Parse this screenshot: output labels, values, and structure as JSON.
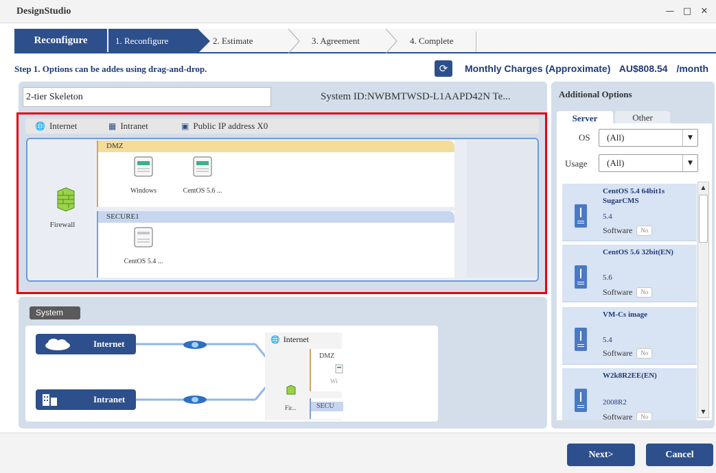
{
  "window": {
    "title": "DesignStudio",
    "minimize_icon": "minimize-icon",
    "maximize_icon": "maximize-icon",
    "close_icon": "close-icon"
  },
  "wizard": {
    "home_label": "Reconfigure",
    "steps": [
      {
        "label": "1. Reconfigure",
        "active": true
      },
      {
        "label": "2. Estimate",
        "active": false
      },
      {
        "label": "3. Agreement",
        "active": false
      },
      {
        "label": "4. Complete",
        "active": false
      }
    ]
  },
  "step_bar": {
    "instruction": "Step 1. Options can be addes using drag-and-drop.",
    "refresh_icon": "refresh-icon",
    "monthly_label": "Monthly Charges (Approximate)",
    "monthly_amount": "AU$808.54",
    "monthly_unit": "/month"
  },
  "configure": {
    "system_name_value": "2-tier Skeleton",
    "system_id": "System ID:NWBMTWSD-L1AAPD42N  Te...",
    "network_tabs": [
      {
        "label": "Internet",
        "icon": "globe-icon"
      },
      {
        "label": "Intranet",
        "icon": "building-icon"
      },
      {
        "label": "Public IP address X0",
        "icon": "ip-icon"
      }
    ],
    "firewall_label": "Firewall",
    "zones": [
      {
        "name": "DMZ",
        "servers": [
          "Windows",
          "CentOS 5.6 ..."
        ]
      },
      {
        "name": "SECURE1",
        "servers": [
          "CentOS 5.4 ..."
        ]
      }
    ]
  },
  "system_panel": {
    "badge": "System",
    "internet_label": "Internet",
    "intranet_label": "Intranet",
    "mini_internet_label": "Internet",
    "mini_dmz_label": "DMZ",
    "mini_windows_label": "Wi",
    "mini_secure_label": "SECU",
    "mini_firewall_label": "Fir..."
  },
  "additional_options": {
    "title": "Additional Options",
    "tabs": {
      "server": "Server",
      "other": "Other"
    },
    "filters": {
      "os_label": "OS",
      "os_value": "(All)",
      "usage_label": "Usage",
      "usage_value": "(All)"
    },
    "items": [
      {
        "name": "CentOS 5.4 64bit1s SugarCMS",
        "version": "5.4",
        "software_label": "Software",
        "software_value": "No"
      },
      {
        "name": "CentOS 5.6 32bit(EN)",
        "version": "5.6",
        "software_label": "Software",
        "software_value": "No"
      },
      {
        "name": "VM-Cs image",
        "version": "5.4",
        "software_label": "Software",
        "software_value": "No"
      },
      {
        "name": "W2k8R2EE(EN)",
        "version": "2008R2",
        "software_label": "Software",
        "software_value": "No"
      }
    ]
  },
  "footer": {
    "next_label": "Next>",
    "cancel_label": "Cancel"
  },
  "colors": {
    "brand_blue": "#2d4f8c",
    "panel_bg": "#d4deea",
    "highlight_red": "#e8000c",
    "dmz_yellow": "#f4dd99",
    "secure_blue": "#c7d6ee"
  }
}
